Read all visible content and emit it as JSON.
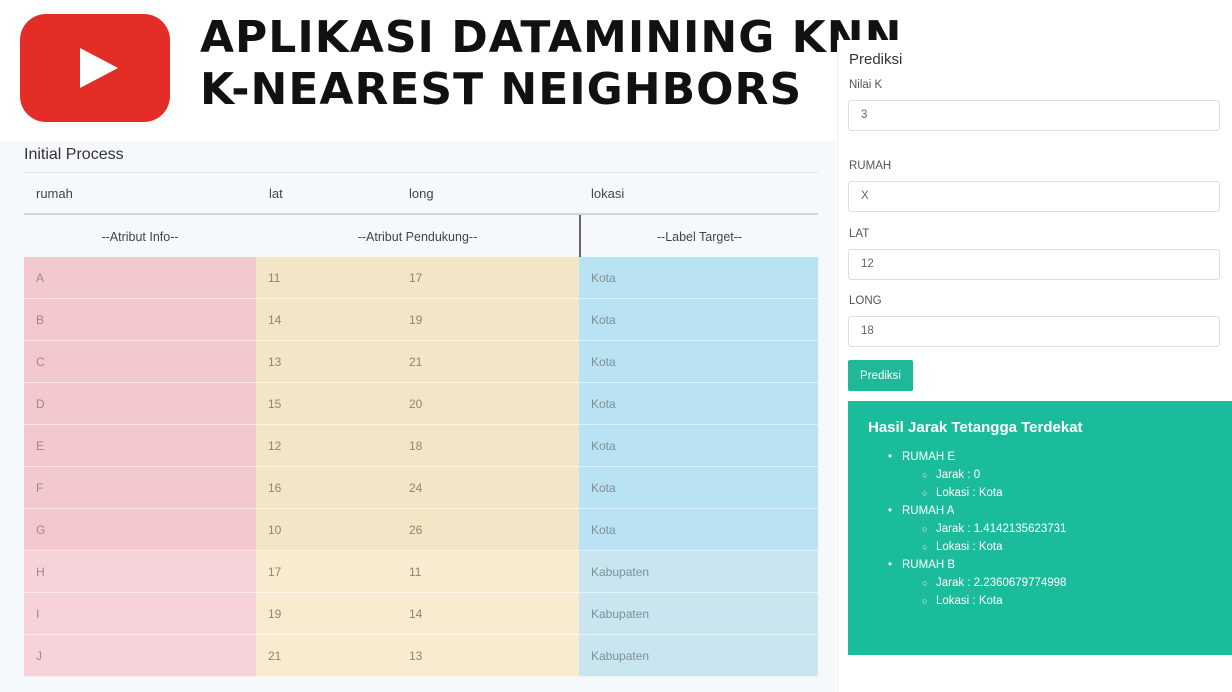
{
  "banner": {
    "title_line1": "Aplikasi Datamining KNN",
    "title_line2": "K-Nearest Neighbors",
    "logo_icon": "youtube-logo-icon",
    "logo_color": "#e52d27"
  },
  "initial_process": {
    "title": "Initial Process",
    "columns": [
      "rumah",
      "lat",
      "long",
      "lokasi"
    ],
    "groups": [
      "--Atribut Info--",
      "--Atribut Pendukung--",
      "--Label Target--"
    ],
    "rows": [
      {
        "rumah": "A",
        "lat": "11",
        "long": "17",
        "lokasi": "Kota"
      },
      {
        "rumah": "B",
        "lat": "14",
        "long": "19",
        "lokasi": "Kota"
      },
      {
        "rumah": "C",
        "lat": "13",
        "long": "21",
        "lokasi": "Kota"
      },
      {
        "rumah": "D",
        "lat": "15",
        "long": "20",
        "lokasi": "Kota"
      },
      {
        "rumah": "E",
        "lat": "12",
        "long": "18",
        "lokasi": "Kota"
      },
      {
        "rumah": "F",
        "lat": "16",
        "long": "24",
        "lokasi": "Kota"
      },
      {
        "rumah": "G",
        "lat": "10",
        "long": "26",
        "lokasi": "Kota"
      },
      {
        "rumah": "H",
        "lat": "17",
        "long": "11",
        "lokasi": "Kabupaten"
      },
      {
        "rumah": "I",
        "lat": "19",
        "long": "14",
        "lokasi": "Kabupaten"
      },
      {
        "rumah": "J",
        "lat": "21",
        "long": "13",
        "lokasi": "Kabupaten"
      }
    ]
  },
  "prediksi": {
    "title": "Prediksi",
    "nilai_k_label": "Nilai K",
    "nilai_k_value": "3",
    "rumah_label": "RUMAH",
    "rumah_value": "X",
    "lat_label": "LAT",
    "lat_value": "12",
    "long_label": "LONG",
    "long_value": "18",
    "button_label": "Prediksi",
    "accent_color": "#1bbc9b"
  },
  "hasil": {
    "title": "Hasil Jarak Tetangga Terdekat",
    "items": [
      {
        "rumah": "RUMAH E",
        "jarak": "Jarak : 0",
        "lokasi": "Lokasi : Kota"
      },
      {
        "rumah": "RUMAH A",
        "jarak": "Jarak : 1.4142135623731",
        "lokasi": "Lokasi : Kota"
      },
      {
        "rumah": "RUMAH B",
        "jarak": "Jarak : 2.2360679774998",
        "lokasi": "Lokasi : Kota"
      }
    ]
  }
}
